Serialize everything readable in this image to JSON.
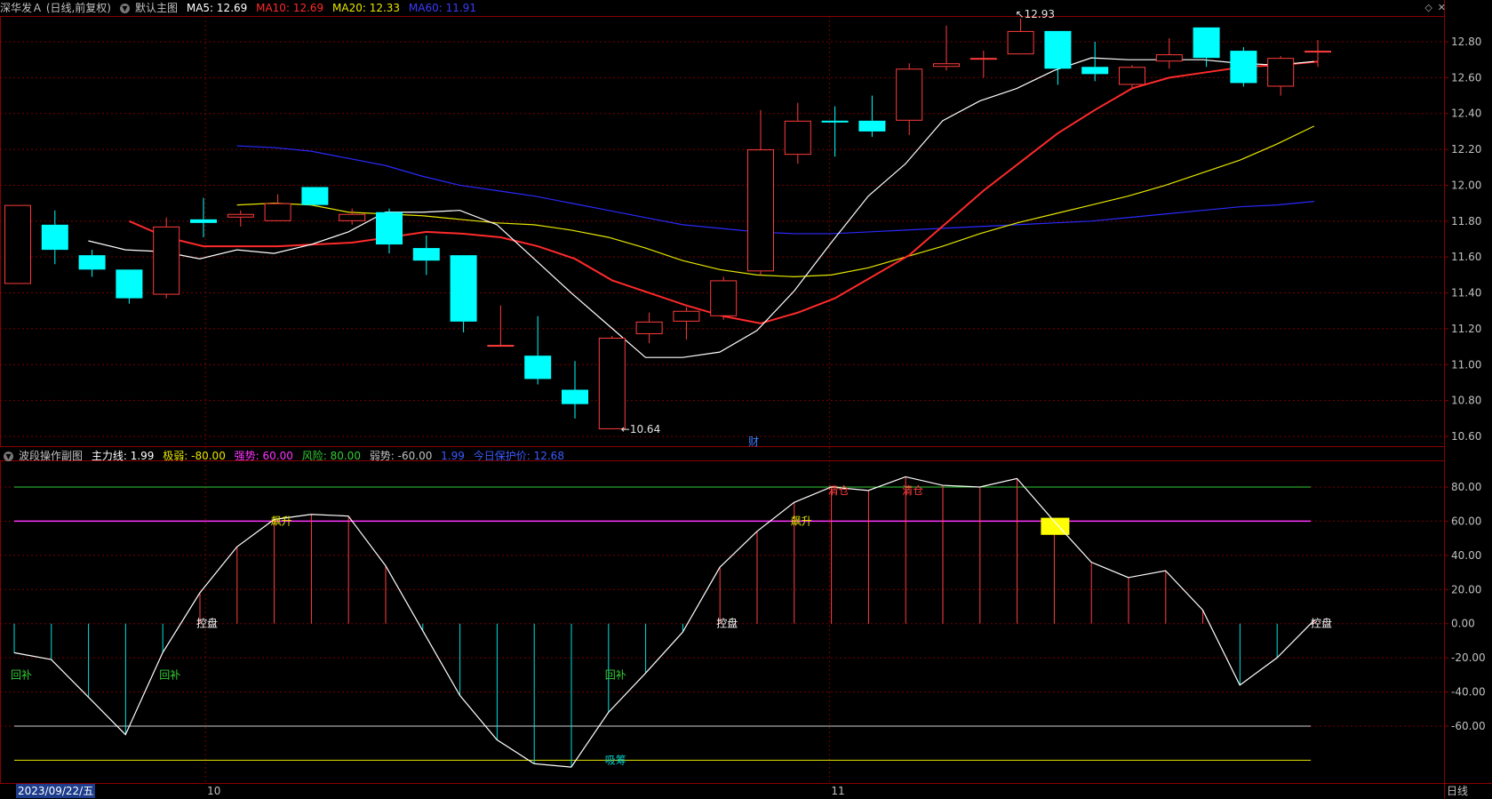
{
  "header": {
    "title": "深华发Ａ (日线,前复权)",
    "chart_name": "默认主图",
    "ma5": {
      "label": "MA5:",
      "value": "12.69",
      "color": "#ffffff"
    },
    "ma10": {
      "label": "MA10:",
      "value": "12.69",
      "color": "#ff2a2a"
    },
    "ma20": {
      "label": "MA20:",
      "value": "12.33",
      "color": "#e6e600"
    },
    "ma60": {
      "label": "MA60:",
      "value": "11.91",
      "color": "#2a2aff"
    }
  },
  "sub_header": {
    "title": "波段操作副图",
    "main_line": {
      "label": "主力线:",
      "value": "1.99",
      "color": "#ffffff"
    },
    "weak_extreme": {
      "label": "极弱:",
      "value": "-80.00",
      "color": "#e6e600"
    },
    "strong": {
      "label": "强势:",
      "value": "60.00",
      "color": "#ff33ff"
    },
    "risk": {
      "label": "风险:",
      "value": "80.00",
      "color": "#33cc33"
    },
    "weak": {
      "label": "弱势:",
      "value": "-60.00",
      "color": "#c0c0c0"
    },
    "extra_value": "1.99",
    "today_protect": {
      "label": "今日保护价:",
      "value": "12.68",
      "color": "#3b5bff"
    }
  },
  "icons": {
    "diamond": "diamond-icon",
    "close": "close-icon"
  },
  "colors": {
    "up": "#ff3c3c",
    "down": "#00ffff",
    "grid": "#8b0000",
    "axis_text": "#c0c0c0"
  },
  "main_axis_ticks": [
    "12.80",
    "12.60",
    "12.40",
    "12.20",
    "12.00",
    "11.80",
    "11.60",
    "11.40",
    "11.20",
    "11.00",
    "10.80",
    "10.60"
  ],
  "sub_axis_ticks": [
    "80.00",
    "60.00",
    "40.00",
    "20.00",
    "0.00",
    "-20.00",
    "-40.00",
    "-60.00"
  ],
  "annotations": {
    "high": "12.93",
    "low": "10.64",
    "cai": "财"
  },
  "date_axis": {
    "selected_date": "2023/09/22/五",
    "month_10": "10",
    "month_11": "11",
    "period": "日线"
  },
  "chart_data": [
    {
      "type": "candlestick",
      "name": "main",
      "ylim": [
        10.55,
        12.9
      ],
      "candles": [
        {
          "o": 11.45,
          "h": 11.89,
          "l": 11.45,
          "c": 11.89
        },
        {
          "o": 11.78,
          "h": 11.86,
          "l": 11.56,
          "c": 11.64
        },
        {
          "o": 11.61,
          "h": 11.64,
          "l": 11.49,
          "c": 11.53
        },
        {
          "o": 11.53,
          "h": 11.53,
          "l": 11.34,
          "c": 11.37
        },
        {
          "o": 11.39,
          "h": 11.82,
          "l": 11.37,
          "c": 11.77
        },
        {
          "o": 11.81,
          "h": 11.93,
          "l": 11.71,
          "c": 11.79
        },
        {
          "o": 11.82,
          "h": 11.86,
          "l": 11.77,
          "c": 11.84
        },
        {
          "o": 11.8,
          "h": 11.95,
          "l": 11.8,
          "c": 11.9
        },
        {
          "o": 11.99,
          "h": 11.99,
          "l": 11.89,
          "c": 11.89
        },
        {
          "o": 11.8,
          "h": 11.87,
          "l": 11.78,
          "c": 11.84
        },
        {
          "o": 11.85,
          "h": 11.87,
          "l": 11.62,
          "c": 11.67
        },
        {
          "o": 11.65,
          "h": 11.72,
          "l": 11.5,
          "c": 11.58
        },
        {
          "o": 11.61,
          "h": 11.61,
          "l": 11.18,
          "c": 11.24
        },
        {
          "o": 11.11,
          "h": 11.33,
          "l": 11.1,
          "c": 11.11
        },
        {
          "o": 11.05,
          "h": 11.27,
          "l": 10.89,
          "c": 10.92
        },
        {
          "o": 10.86,
          "h": 11.02,
          "l": 10.7,
          "c": 10.78
        },
        {
          "o": 10.64,
          "h": 11.16,
          "l": 10.64,
          "c": 11.15
        },
        {
          "o": 11.17,
          "h": 11.29,
          "l": 11.12,
          "c": 11.24
        },
        {
          "o": 11.24,
          "h": 11.32,
          "l": 11.14,
          "c": 11.3
        },
        {
          "o": 11.27,
          "h": 11.49,
          "l": 11.25,
          "c": 11.47
        },
        {
          "o": 11.52,
          "h": 12.42,
          "l": 11.5,
          "c": 12.2
        },
        {
          "o": 12.17,
          "h": 12.46,
          "l": 12.12,
          "c": 12.36
        },
        {
          "o": 12.36,
          "h": 12.44,
          "l": 12.16,
          "c": 12.35
        },
        {
          "o": 12.36,
          "h": 12.5,
          "l": 12.27,
          "c": 12.3
        },
        {
          "o": 12.36,
          "h": 12.68,
          "l": 12.28,
          "c": 12.65
        },
        {
          "o": 12.66,
          "h": 12.89,
          "l": 12.64,
          "c": 12.68
        },
        {
          "o": 12.7,
          "h": 12.75,
          "l": 12.6,
          "c": 12.71
        },
        {
          "o": 12.73,
          "h": 12.93,
          "l": 12.73,
          "c": 12.86
        },
        {
          "o": 12.86,
          "h": 12.86,
          "l": 12.56,
          "c": 12.65
        },
        {
          "o": 12.66,
          "h": 12.8,
          "l": 12.58,
          "c": 12.62
        },
        {
          "o": 12.56,
          "h": 12.67,
          "l": 12.54,
          "c": 12.66
        },
        {
          "o": 12.69,
          "h": 12.82,
          "l": 12.65,
          "c": 12.73
        },
        {
          "o": 12.88,
          "h": 12.88,
          "l": 12.66,
          "c": 12.71
        },
        {
          "o": 12.75,
          "h": 12.77,
          "l": 12.55,
          "c": 12.57
        },
        {
          "o": 12.55,
          "h": 12.72,
          "l": 12.5,
          "c": 12.71
        },
        {
          "o": 12.75,
          "h": 12.81,
          "l": 12.66,
          "c": 12.75
        }
      ],
      "ma5": [
        11.69,
        11.64,
        11.63,
        11.59,
        11.64,
        11.62,
        11.67,
        11.74,
        11.85,
        11.85,
        11.86,
        11.78,
        11.59,
        11.4,
        11.22,
        11.04,
        11.04,
        11.07,
        11.19,
        11.41,
        11.68,
        11.94,
        12.12,
        12.36,
        12.47,
        12.54,
        12.64,
        12.71,
        12.7,
        12.7,
        12.7,
        12.68,
        12.67,
        12.69
      ],
      "ma10": [
        11.8,
        11.71,
        11.66,
        11.66,
        11.66,
        11.67,
        11.68,
        11.71,
        11.74,
        11.73,
        11.71,
        11.66,
        11.59,
        11.47,
        11.4,
        11.33,
        11.27,
        11.23,
        11.29,
        11.37,
        11.49,
        11.61,
        11.79,
        11.97,
        12.13,
        12.29,
        12.42,
        12.54,
        12.6,
        12.63,
        12.66,
        12.67,
        12.69
      ],
      "ma20": [
        11.89,
        11.9,
        11.89,
        11.85,
        11.84,
        11.83,
        11.81,
        11.79,
        11.78,
        11.75,
        11.71,
        11.65,
        11.58,
        11.53,
        11.5,
        11.49,
        11.5,
        11.54,
        11.6,
        11.66,
        11.73,
        11.79,
        11.84,
        11.89,
        11.94,
        12.0,
        12.07,
        12.14,
        12.23,
        12.33
      ],
      "ma60": [
        12.22,
        12.21,
        12.19,
        12.15,
        12.11,
        12.05,
        12.0,
        11.97,
        11.94,
        11.9,
        11.86,
        11.82,
        11.78,
        11.76,
        11.74,
        11.73,
        11.73,
        11.74,
        11.75,
        11.76,
        11.77,
        11.78,
        11.79,
        11.8,
        11.82,
        11.84,
        11.86,
        11.88,
        11.89,
        11.91
      ]
    },
    {
      "type": "line",
      "name": "sub",
      "ylim": [
        -85,
        95
      ],
      "levels": {
        "risk": 80,
        "strong": 60,
        "weak": -60,
        "extreme_weak": -80
      },
      "main_line": [
        -17,
        -21,
        -43,
        -65,
        -17,
        18,
        45,
        61,
        64,
        63,
        34,
        -4,
        -42,
        -68,
        -82,
        -84,
        -52,
        -29,
        -5,
        33,
        54,
        71,
        80,
        78,
        86,
        81,
        80,
        85,
        60,
        36,
        27,
        31,
        8,
        -36,
        -20,
        1.99
      ],
      "labels": [
        {
          "i": 0,
          "text": "回补",
          "color": "#33cc33",
          "v": -30
        },
        {
          "i": 4,
          "text": "回补",
          "color": "#33cc33",
          "v": -30
        },
        {
          "i": 5,
          "text": "控盘",
          "color": "#ffffff",
          "v": 0
        },
        {
          "i": 7,
          "text": "飙升",
          "color": "#e6e600",
          "v": 60
        },
        {
          "i": 16,
          "text": "回补",
          "color": "#33cc33",
          "v": -30
        },
        {
          "i": 16,
          "text": "吸筹",
          "color": "#00cccc",
          "v": -80
        },
        {
          "i": 19,
          "text": "控盘",
          "color": "#ffffff",
          "v": 0
        },
        {
          "i": 21,
          "text": "飙升",
          "color": "#e6e600",
          "v": 60
        },
        {
          "i": 22,
          "text": "清仓",
          "color": "#ff3c3c",
          "v": 78
        },
        {
          "i": 24,
          "text": "清仓",
          "color": "#ff3c3c",
          "v": 78
        },
        {
          "i": 35,
          "text": "控盘",
          "color": "#ffffff",
          "v": 0
        }
      ],
      "highlight": {
        "i": 28,
        "from": 52,
        "to": 62,
        "color": "#ffff00"
      }
    }
  ]
}
